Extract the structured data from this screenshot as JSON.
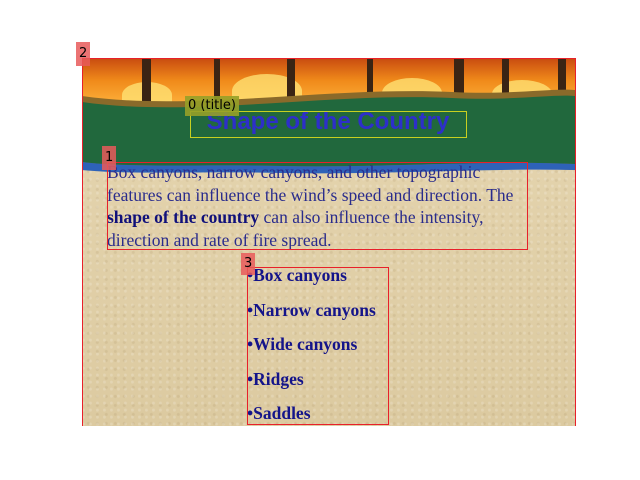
{
  "slide": {
    "title": "Shape of the Country",
    "paragraph": {
      "part1": "Box canyons, narrow canyons, and other topographic features can influence the wind’s speed and direction. The ",
      "bold": "shape of the country",
      "part2": " can also influence  the intensity, direction and rate of fire spread."
    },
    "bullets": [
      "•Box canyons",
      "•Narrow canyons",
      "•Wide canyons",
      "•Ridges",
      "•Saddles"
    ]
  },
  "annotations": {
    "title_tag": "0 (title)",
    "body_tag": "1",
    "slide_tag": "2",
    "list_tag": "3"
  },
  "colors": {
    "title": "#2d2fc9",
    "text": "#2a2c8c",
    "band_green": "#21683d",
    "band_blue": "#2e62b8",
    "annotation_red": "#e8202a",
    "annotation_yellow": "#c8d020"
  }
}
